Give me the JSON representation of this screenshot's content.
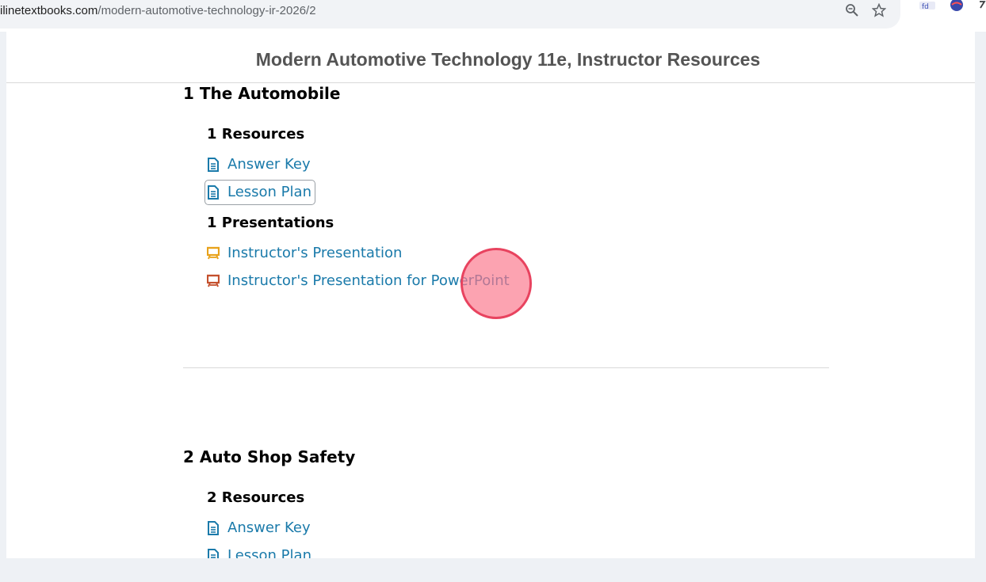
{
  "browser": {
    "url_visible": "ilinetextbooks.com",
    "url_path": "/modern-automotive-technology-ir-2026/2",
    "icons": [
      "zoom-icon",
      "bookmark-star-icon",
      "profile-icon",
      "extension-icon",
      "extension-icon-2"
    ]
  },
  "header": {
    "title": "Modern Automotive Technology 11e, Instructor Resources"
  },
  "chapters": [
    {
      "title": "1 The Automobile",
      "resources_heading": "1 Resources",
      "resources": [
        {
          "label": "Answer Key",
          "icon": "document-icon"
        },
        {
          "label": "Lesson Plan",
          "icon": "document-icon",
          "focused": true
        }
      ],
      "presentations_heading": "1 Presentations",
      "presentations": [
        {
          "label": "Instructor's Presentation",
          "icon": "presentation-icon",
          "color": "#e8a21b"
        },
        {
          "label": "Instructor's Presentation for PowerPoint",
          "icon": "powerpoint-icon",
          "color": "#c4502d"
        }
      ]
    },
    {
      "title": "2 Auto Shop Safety",
      "resources_heading": "2 Resources",
      "resources": [
        {
          "label": "Answer Key",
          "icon": "document-icon"
        },
        {
          "label": "Lesson Plan",
          "icon": "document-icon"
        }
      ]
    }
  ],
  "colors": {
    "link": "#1a7aaa",
    "doc_icon": "#1a7aaa",
    "presentation_icon": "#e8a21b",
    "powerpoint_icon": "#c4502d",
    "click_indicator": "#e8435f"
  }
}
